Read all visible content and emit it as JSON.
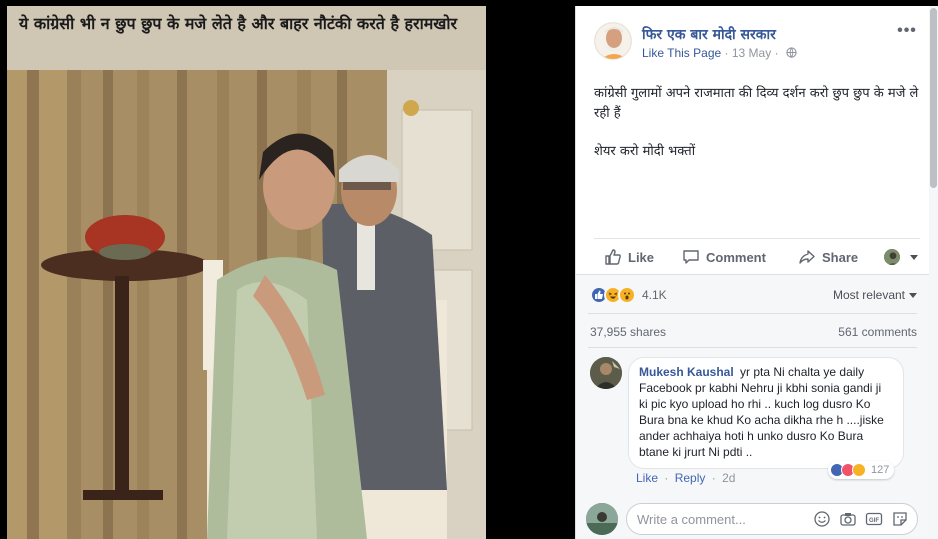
{
  "photo": {
    "caption": "ये कांग्रेसी भी न छुप छुप के मजे लेते है और बाहर नौटंकी करते है हरामखोर"
  },
  "post": {
    "page_name": "फिर एक बार मोदी सरकार",
    "like_page": "Like This Page",
    "date": "13 May",
    "meta_sep": "·",
    "more_label": "•••",
    "text_line1": "कांग्रेसी गुलामों अपने राजमाता की दिव्य दर्शन करो छुप छुप के मजे ले रही हैं",
    "text_line2": "शेयर करो मोदी भक्तों"
  },
  "actions": {
    "like": "Like",
    "comment": "Comment",
    "share": "Share"
  },
  "feedback": {
    "reaction_count": "4.1K",
    "sort_label": "Most relevant",
    "shares": "37,955 shares",
    "comments": "561 comments"
  },
  "comment": {
    "author": "Mukesh Kaushal",
    "text": "yr pta Ni chalta ye daily Facebook pr kabhi Nehru ji kbhi sonia gandi ji ki pic kyo upload ho rhi .. kuch log dusro Ko Bura bna ke khud Ko acha dikha rhe h ....jiske ander achhaiya hoti h unko dusro Ko Bura btane ki jrurt Ni pdti ..",
    "reaction_count": "127",
    "like": "Like",
    "reply": "Reply",
    "sep": "·",
    "time": "2d"
  },
  "composer": {
    "placeholder": "Write a comment..."
  },
  "colors": {
    "link": "#365899",
    "meta": "#90949c",
    "like_blue": "#4267b2",
    "love_red": "#f25268",
    "haha_yellow": "#f7b125"
  }
}
